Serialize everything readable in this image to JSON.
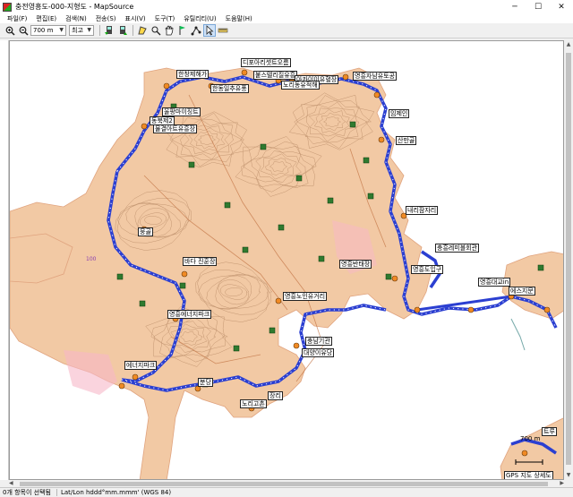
{
  "window": {
    "title": "충전영흥도-000-지형도 - MapSource",
    "controls": [
      "─",
      "☐",
      "✕"
    ]
  },
  "menu": [
    {
      "label": "파일(F)"
    },
    {
      "label": "편집(E)"
    },
    {
      "label": "검색(N)"
    },
    {
      "label": "전송(S)"
    },
    {
      "label": "표시(V)"
    },
    {
      "label": "도구(T)"
    },
    {
      "label": "유틸리티(U)"
    },
    {
      "label": "도움말(H)"
    }
  ],
  "toolbar": {
    "zoom_value": "700 m",
    "detail_value": "최고"
  },
  "map": {
    "colors": {
      "water": "#ffffff",
      "land": "#f2c9a4",
      "route": "#2b3fd1",
      "contour": "#b88a66"
    },
    "labels": [
      "디포아리셋트오름",
      "한창제해가",
      "붙스텔리질유흥",
      "영흥자남유토공",
      "아카이이유혈장",
      "노리동유적해",
      "한동일추유풍",
      "울팡마이징트",
      "동북제2",
      "물결아트유흥장",
      "임제인",
      "산만골",
      "내리잠자리",
      "충흥레미블회관",
      "영흥반태장",
      "영흥도입구",
      "영흥대교in",
      "에스지문",
      "뭉골",
      "100",
      "바다 진훈장",
      "영흥노인유거리",
      "영흥에너지파크",
      "대양이유당",
      "충남기관",
      "분당",
      "에너지파크",
      "장리",
      "노리고촌",
      "트루",
      "700 m",
      "GPS 지도 상세도"
    ],
    "scale_text": "700 m"
  },
  "status": {
    "selection": "0개 항목이 선택됨",
    "coords": "Lat/Lon hddd°mm.mmm' (WGS 84)"
  }
}
